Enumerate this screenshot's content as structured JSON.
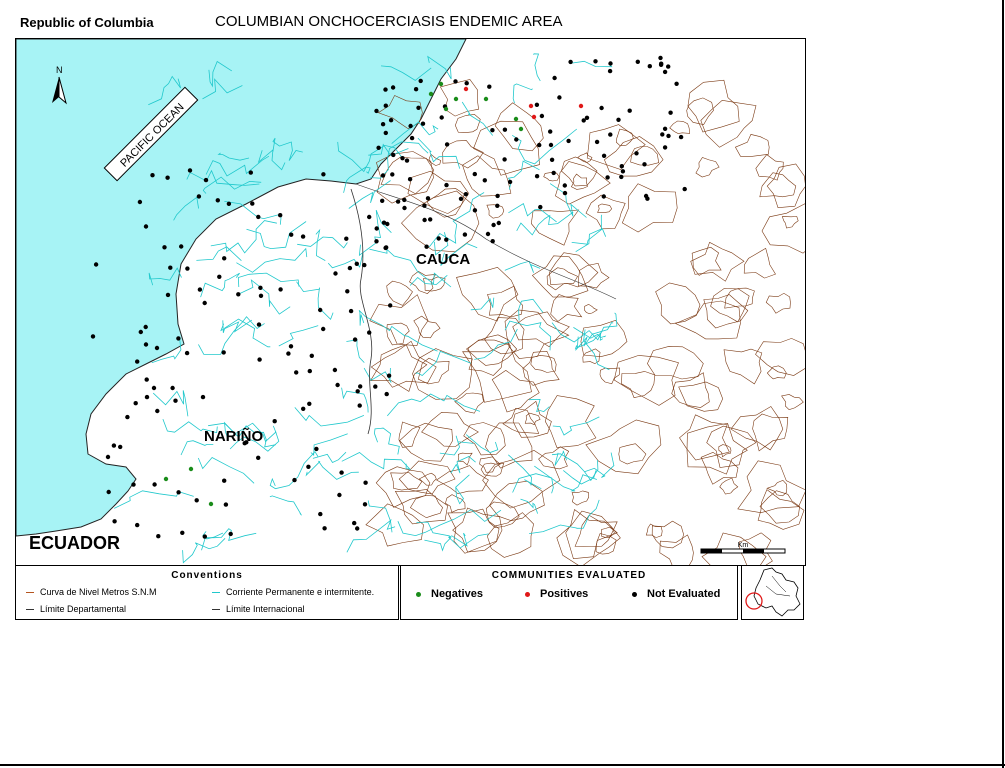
{
  "header": {
    "country": "Republic of  Columbia",
    "title": "COLUMBIAN ONCHOCERCIASIS ENDEMIC AREA"
  },
  "map": {
    "ocean_label": "PACIFIC OCEAN",
    "north_label": "N",
    "regions": {
      "cauca": "CAUCA",
      "narino": "NARIÑO",
      "ecuador": "ECUADOR"
    },
    "scale_label": "Km",
    "colors": {
      "ocean": "#a7f3f5",
      "rivers": "#20c8cc",
      "contours": "#7b3a14",
      "borders": "#222222"
    }
  },
  "conventions": {
    "title": "Conventions",
    "items": [
      {
        "label": "Curva de Nivel Metros S.N.M",
        "color": "#b5541e"
      },
      {
        "label": "Corriente Permanente e intermitente.",
        "color": "#20c8cc"
      },
      {
        "label": "Límite Departamental",
        "color": "#333333"
      },
      {
        "label": "Límite Internacional",
        "color": "#333333"
      }
    ]
  },
  "communities": {
    "title": "COMMUNITIES EVALUATED",
    "items": [
      {
        "label": "Negatives",
        "color": "#1a8c1a"
      },
      {
        "label": "Positives",
        "color": "#e01818"
      },
      {
        "label": "Not Evaluated",
        "color": "#000000"
      }
    ]
  }
}
